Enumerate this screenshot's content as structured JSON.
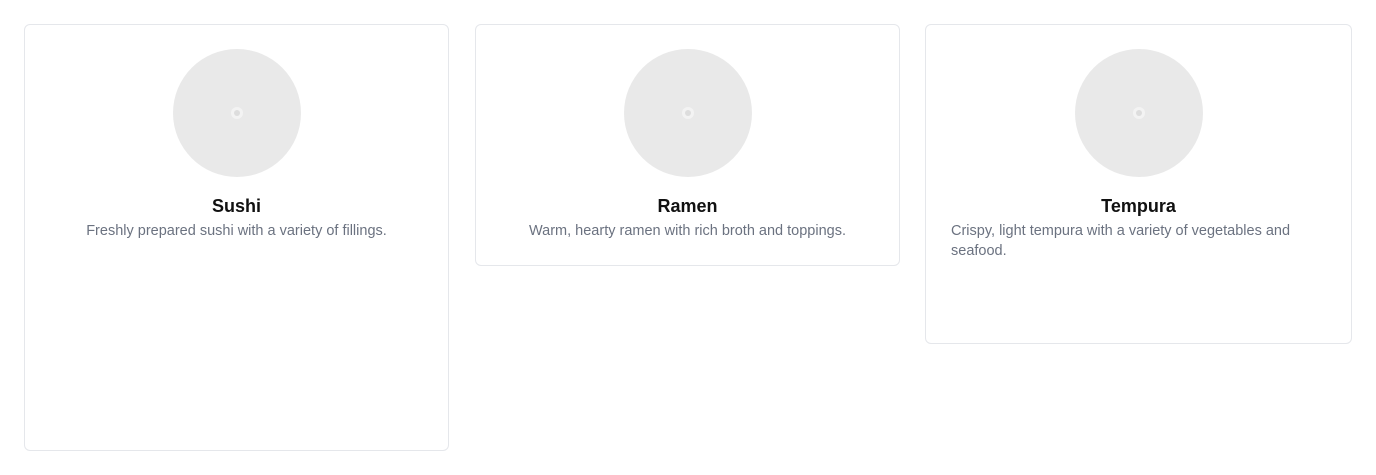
{
  "cards": [
    {
      "title": "Sushi",
      "description": "Freshly prepared sushi with a variety of fillings.",
      "image_icon": "image-placeholder-icon"
    },
    {
      "title": "Ramen",
      "description": "Warm, hearty ramen with rich broth and toppings.",
      "image_icon": "image-placeholder-icon"
    },
    {
      "title": "Tempura",
      "description": "Crispy, light tempura with a variety of vegetables and seafood.",
      "image_icon": "image-placeholder-icon"
    }
  ]
}
